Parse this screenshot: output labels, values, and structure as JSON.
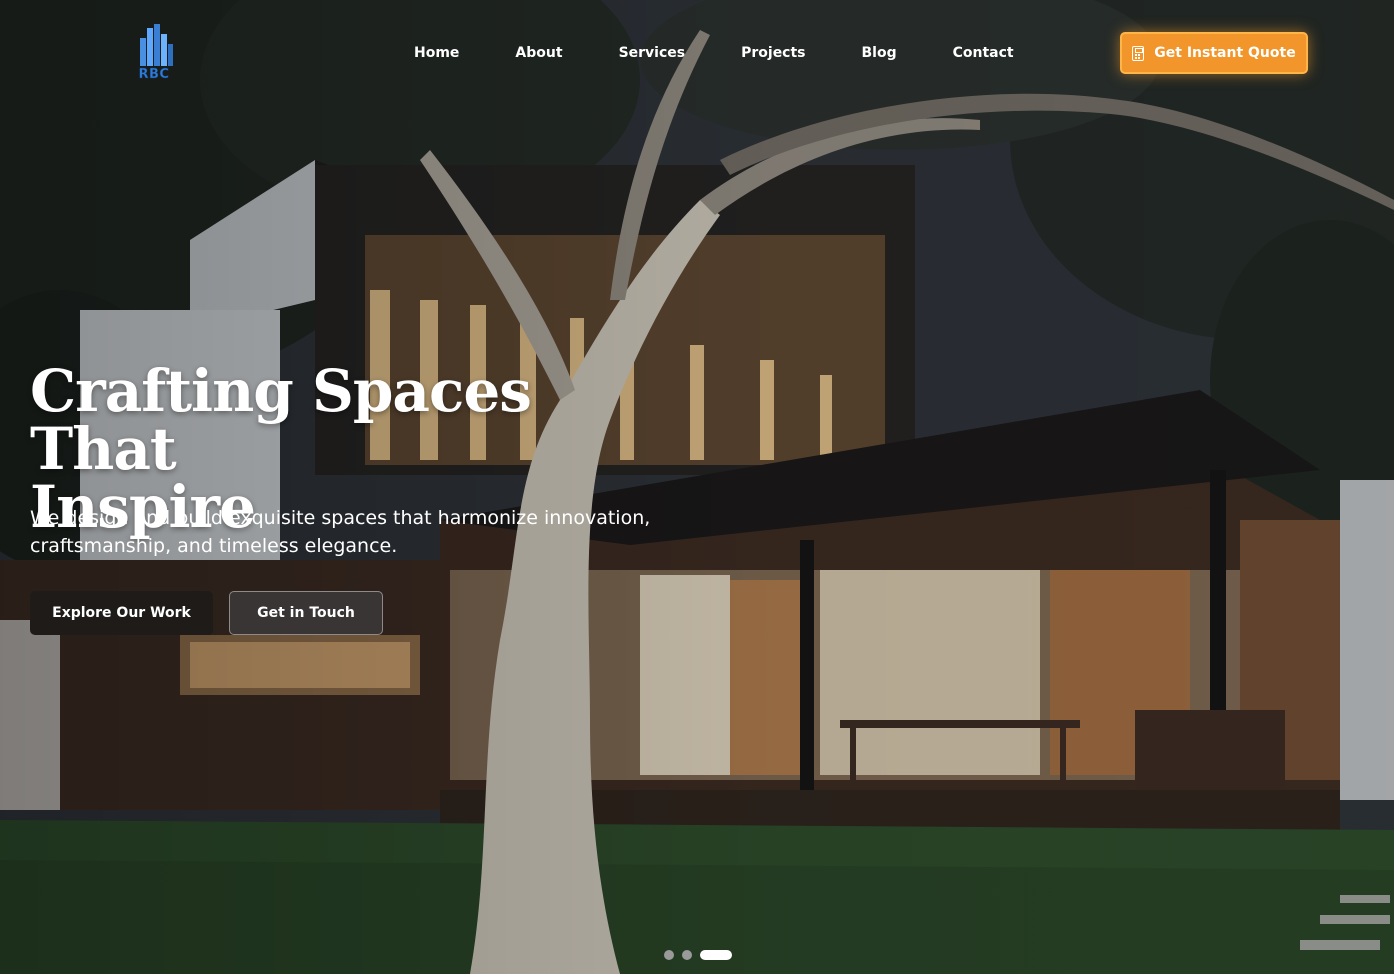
{
  "brand": {
    "logo_text": "RBC"
  },
  "nav": {
    "items": [
      {
        "label": "Home"
      },
      {
        "label": "About"
      },
      {
        "label": "Services"
      },
      {
        "label": "Projects"
      },
      {
        "label": "Blog"
      },
      {
        "label": "Contact"
      }
    ]
  },
  "cta": {
    "quote_label": "Get Instant Quote",
    "quote_icon": "calculator-icon"
  },
  "hero": {
    "title_line1": "Crafting Spaces That",
    "title_line2": "Inspire",
    "subtitle": "We design and build exquisite spaces that harmonize innovation, craftsmanship, and timeless elegance.",
    "primary_button": "Explore Our Work",
    "secondary_button": "Get in Touch"
  },
  "carousel": {
    "slide_count": 3,
    "active_index": 3
  },
  "colors": {
    "accent": "#f2952a",
    "button_dark": "#1e1b18",
    "logo_blue": "#2f7bd6"
  }
}
